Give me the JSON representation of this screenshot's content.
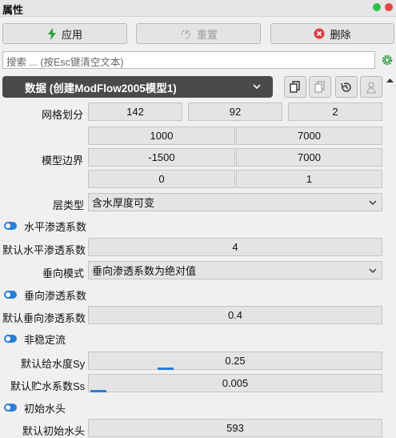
{
  "window": {
    "title": "属性"
  },
  "toolbar": {
    "apply_label": "应用",
    "reset_label": "重置",
    "delete_label": "删除"
  },
  "search": {
    "placeholder": "搜索 ... (按Esc键清空文本)"
  },
  "data_selector": {
    "label": "数据 (创建ModFlow2005模型1)"
  },
  "grid": {
    "label": "网格划分",
    "values": [
      "142",
      "92",
      "2"
    ]
  },
  "bounds": {
    "label": "模型边界",
    "row1": [
      "1000",
      "7000"
    ],
    "row2": [
      "-1500",
      "7000"
    ],
    "row3": [
      "0",
      "1"
    ]
  },
  "layer_type": {
    "label": "层类型",
    "value": "含水厚度可变"
  },
  "horizontal": {
    "section": "水平渗透系数",
    "default_label": "默认水平渗透系数",
    "default_value": "4"
  },
  "vertical_mode": {
    "label": "垂向模式",
    "value": "垂向渗透系数为绝对值"
  },
  "vertical": {
    "section": "垂向渗透系数",
    "default_label": "默认垂向渗透系数",
    "default_value": "0.4"
  },
  "transient": {
    "section": "非稳定流",
    "sy_label": "默认给水度Sy",
    "sy_value": "0.25",
    "sy_fill": 0.25,
    "ss_label": "默认贮水系数Ss",
    "ss_value": "0.005",
    "ss_fill": 0.005
  },
  "initial_head": {
    "section": "初始水头",
    "default_label": "默认初始水头",
    "default_value": "593"
  },
  "colors": {
    "accent": "#2a7ed6",
    "selector_bg": "#4a4a4a",
    "apply_icon": "#2e9b3a",
    "delete_icon": "#e03c3c"
  },
  "icons": [
    "bolt-icon",
    "reset-icon",
    "delete-icon",
    "gear-icon",
    "copy-icon",
    "paste-icon",
    "history-icon",
    "user-icon",
    "chevron-down-icon",
    "toggle-icon"
  ]
}
